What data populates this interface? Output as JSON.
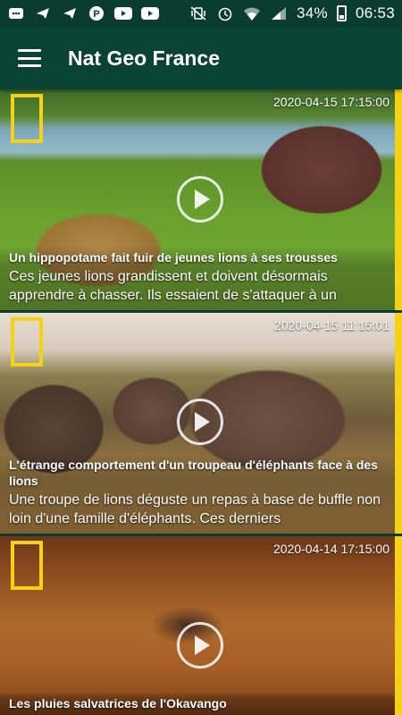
{
  "status_bar": {
    "icons_left": [
      "chat-icon",
      "telegram-icon",
      "telegram-icon",
      "pinterest-icon",
      "youtube-icon",
      "youtube-icon"
    ],
    "battery": "34%",
    "time": "06:53"
  },
  "app_bar": {
    "title": "Nat Geo France"
  },
  "articles": [
    {
      "timestamp": "2020-04-15 17:15:00",
      "title": "Un hippopotame fait fuir de jeunes lions à ses trousses",
      "description": "Ces jeunes lions grandissent et doivent désormais apprendre à chasser. Ils essaient de s'attaquer à un"
    },
    {
      "timestamp": "2020-04-15 11:15:01",
      "title": "L'étrange comportement d'un troupeau d'éléphants face à des lions",
      "description": "Une troupe de lions déguste un repas à base de buffle non loin d'une famille d'éléphants. Ces derniers"
    },
    {
      "timestamp": "2020-04-14 17:15:00",
      "title": "Les pluies salvatrices de l'Okavango",
      "description": ""
    }
  ],
  "colors": {
    "accent": "#f5d215",
    "app_bar": "#0b4236"
  }
}
